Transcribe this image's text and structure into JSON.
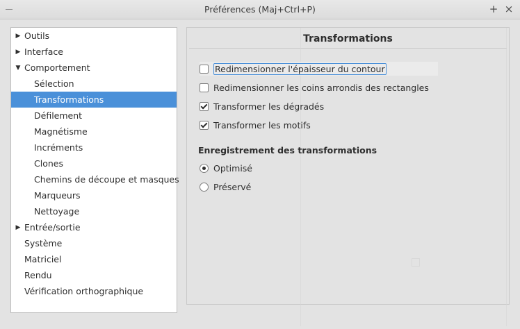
{
  "window": {
    "title": "Préférences (Maj+Ctrl+P)",
    "maximize_glyph": "+",
    "close_glyph": "×"
  },
  "sidebar": {
    "items": [
      {
        "label": "Outils",
        "expander": "right",
        "level": 0,
        "selected": false
      },
      {
        "label": "Interface",
        "expander": "right",
        "level": 0,
        "selected": false
      },
      {
        "label": "Comportement",
        "expander": "down",
        "level": 0,
        "selected": false
      },
      {
        "label": "Sélection",
        "expander": "",
        "level": 1,
        "selected": false
      },
      {
        "label": "Transformations",
        "expander": "",
        "level": 1,
        "selected": true
      },
      {
        "label": "Défilement",
        "expander": "",
        "level": 1,
        "selected": false
      },
      {
        "label": "Magnétisme",
        "expander": "",
        "level": 1,
        "selected": false
      },
      {
        "label": "Incréments",
        "expander": "",
        "level": 1,
        "selected": false
      },
      {
        "label": "Clones",
        "expander": "",
        "level": 1,
        "selected": false
      },
      {
        "label": "Chemins de découpe et masques",
        "expander": "",
        "level": 1,
        "selected": false
      },
      {
        "label": "Marqueurs",
        "expander": "",
        "level": 1,
        "selected": false
      },
      {
        "label": "Nettoyage",
        "expander": "",
        "level": 1,
        "selected": false
      },
      {
        "label": "Entrée/sortie",
        "expander": "right",
        "level": 0,
        "selected": false
      },
      {
        "label": "Système",
        "expander": "",
        "level": 0,
        "selected": false
      },
      {
        "label": "Matriciel",
        "expander": "",
        "level": 0,
        "selected": false
      },
      {
        "label": "Rendu",
        "expander": "",
        "level": 0,
        "selected": false
      },
      {
        "label": "Vérification orthographique",
        "expander": "",
        "level": 0,
        "selected": false
      }
    ]
  },
  "panel": {
    "title": "Transformations",
    "checkboxes": [
      {
        "label": "Redimensionner l'épaisseur du contour",
        "checked": false,
        "focused": true
      },
      {
        "label": "Redimensionner les coins arrondis des rectangles",
        "checked": false,
        "focused": false
      },
      {
        "label": "Transformer les dégradés",
        "checked": true,
        "focused": false
      },
      {
        "label": "Transformer les motifs",
        "checked": true,
        "focused": false
      }
    ],
    "store_section": {
      "heading": "Enregistrement des transformations",
      "options": [
        {
          "label": "Optimisé",
          "selected": true
        },
        {
          "label": "Préservé",
          "selected": false
        }
      ]
    }
  },
  "colors": {
    "selection": "#4a90d9",
    "window_bg": "#e3e3e3",
    "sidebar_bg": "#ffffff"
  }
}
